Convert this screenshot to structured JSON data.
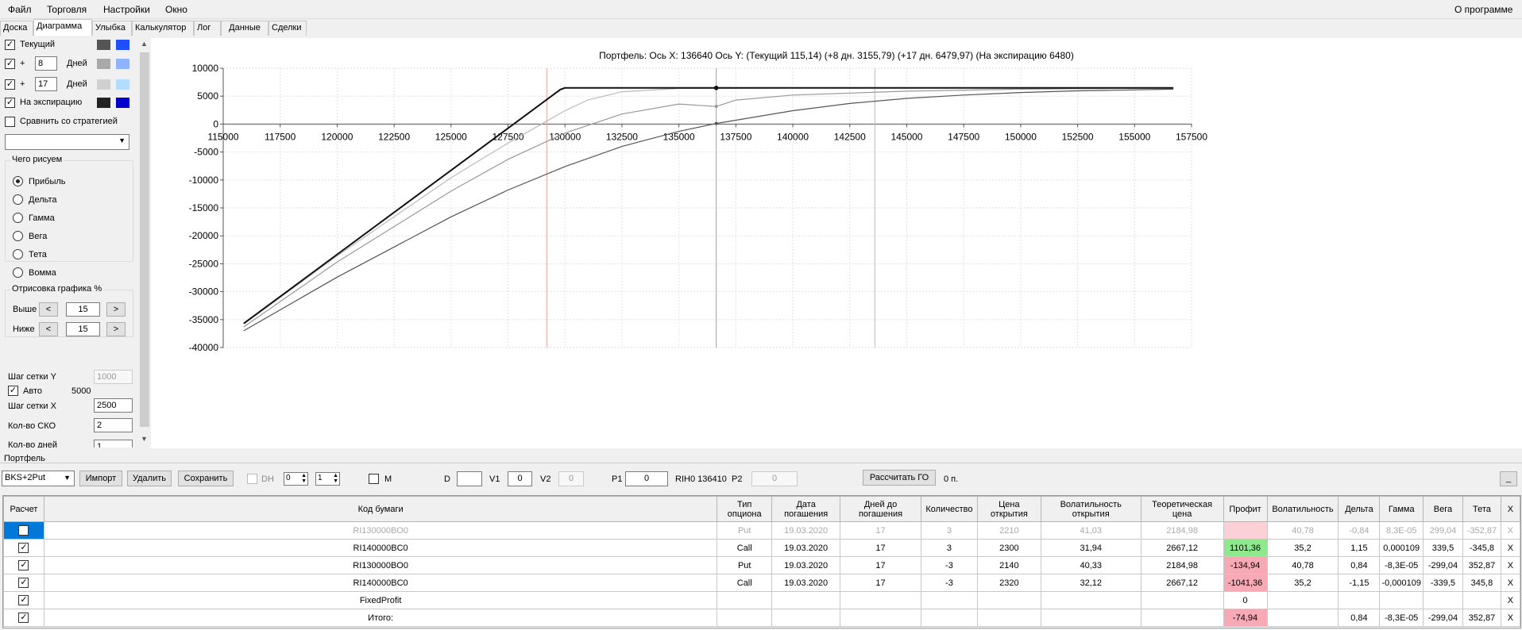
{
  "menu": {
    "file": "Файл",
    "trade": "Торговля",
    "settings": "Настройки",
    "window": "Окно",
    "about": "О программе"
  },
  "tabs": [
    "Доска",
    "Диаграмма",
    "Улыбка",
    "Калькулятор",
    "Лог",
    "Данные",
    "Сделки"
  ],
  "left": {
    "current_label": "Текущий",
    "plus1": "+",
    "days1": "8",
    "days_label1": "Дней",
    "plus2": "+",
    "days2": "17",
    "days_label2": "Дней",
    "expiry_label": "На экспирацию",
    "compare_label": "Сравнить со стратегией",
    "draw_group": "Чего рисуем",
    "radios": [
      "Прибыль",
      "Дельта",
      "Гамма",
      "Вега",
      "Тета",
      "Вомма"
    ],
    "render_group": "Отрисовка графика %",
    "above_label": "Выше",
    "above_val": "15",
    "below_label": "Ниже",
    "below_val": "15",
    "prev": "<",
    "next": ">",
    "grid_y_label": "Шаг сетки Y",
    "grid_y_val": "1000",
    "auto_label": "Авто",
    "auto_val": "5000",
    "grid_x_label": "Шаг сетки X",
    "grid_x_val": "2500",
    "sko_label": "Кол-во СКО",
    "sko_val": "2",
    "days_count_label": "Кол-во дней",
    "days_count_val": "1"
  },
  "colors": {
    "current": [
      "#555555",
      "#1f4fff"
    ],
    "plus8": [
      "#a9a9a9",
      "#8fb4ff"
    ],
    "plus17": [
      "#d0d0d0",
      "#b3dcff"
    ],
    "expiry": [
      "#222222",
      "#0000cc"
    ]
  },
  "chart_data": {
    "type": "line",
    "title": "Портфель: Ось X:  136640 Ось Y:   (Текущий 115,14)  (+8 дн. 3155,79)  (+17 дн. 6479,97)  (На экспирацию 6480)",
    "xlim": [
      115000,
      157500
    ],
    "ylim": [
      -40000,
      10000
    ],
    "x_ticks": [
      115000,
      117500,
      120000,
      122500,
      125000,
      127500,
      130000,
      132500,
      135000,
      137500,
      140000,
      142500,
      145000,
      147500,
      150000,
      152500,
      155000,
      157500
    ],
    "y_ticks": [
      10000,
      5000,
      0,
      -5000,
      -10000,
      -15000,
      -20000,
      -25000,
      -30000,
      -35000,
      -40000
    ],
    "vlines": [
      {
        "x": 129200,
        "color": "#f0a0a0"
      },
      {
        "x": 136640,
        "color": "#9999cc"
      },
      {
        "x": 143600,
        "color": "#f0a0a0"
      }
    ],
    "series": [
      {
        "color": "#111111",
        "width": 2,
        "points": [
          [
            115900,
            -35700
          ],
          [
            129800,
            6200
          ],
          [
            130000,
            6480
          ],
          [
            156700,
            6480
          ]
        ]
      },
      {
        "color": "#bbbbbb",
        "width": 1.2,
        "points": [
          [
            115900,
            -35800
          ],
          [
            120000,
            -23600
          ],
          [
            125000,
            -9600
          ],
          [
            127500,
            -3400
          ],
          [
            128800,
            -400
          ],
          [
            130000,
            2400
          ],
          [
            131000,
            4300
          ],
          [
            132500,
            5800
          ],
          [
            135000,
            6380
          ],
          [
            140000,
            6470
          ],
          [
            156700,
            6480
          ]
        ]
      },
      {
        "color": "#999999",
        "width": 1.2,
        "points": [
          [
            115900,
            -36300
          ],
          [
            120000,
            -24700
          ],
          [
            125000,
            -12000
          ],
          [
            127500,
            -6300
          ],
          [
            130000,
            -1600
          ],
          [
            132500,
            1800
          ],
          [
            135000,
            3600
          ],
          [
            136640,
            3160
          ],
          [
            137500,
            4300
          ],
          [
            140000,
            5200
          ],
          [
            145000,
            5900
          ],
          [
            150000,
            6250
          ],
          [
            156700,
            6450
          ]
        ]
      },
      {
        "color": "#555555",
        "width": 1.2,
        "points": [
          [
            115900,
            -37000
          ],
          [
            120000,
            -27400
          ],
          [
            122500,
            -22000
          ],
          [
            125000,
            -16600
          ],
          [
            127500,
            -11800
          ],
          [
            130000,
            -7600
          ],
          [
            132500,
            -4000
          ],
          [
            135000,
            -1300
          ],
          [
            136640,
            115
          ],
          [
            137500,
            700
          ],
          [
            140000,
            2400
          ],
          [
            142500,
            3700
          ],
          [
            145000,
            4600
          ],
          [
            147500,
            5200
          ],
          [
            150000,
            5650
          ],
          [
            152500,
            5950
          ],
          [
            156700,
            6250
          ]
        ]
      }
    ],
    "markers": [
      {
        "x": 136640,
        "y": 6480,
        "color": "#111111"
      },
      {
        "x": 136640,
        "y": 3160,
        "color": "#999999"
      },
      {
        "x": 136640,
        "y": 115,
        "color": "#555555"
      }
    ]
  },
  "portfolio": {
    "label": "Портфель",
    "name": "BKS+2Put",
    "import": "Импорт",
    "delete": "Удалить",
    "save": "Сохранить",
    "dh": "DH",
    "dh_v1": "0",
    "dh_v2": "1",
    "m": "M",
    "d": "D",
    "v1": "V1",
    "v1_val": "0",
    "v2": "V2",
    "v2_val": "0",
    "p1": "P1",
    "p1_val": "0",
    "rih": "RIH0 136410",
    "p2": "P2",
    "p2_val": "0",
    "calc_go": "Рассчитать ГО",
    "go_val": "0 п.",
    "minimize": "_"
  },
  "table": {
    "headers": [
      "Расчет",
      "Код бумаги",
      "Тип опциона",
      "Дата погашения",
      "Дней до погашения",
      "Количество",
      "Цена открытия",
      "Волатильность открытия",
      "Теоретическая цена",
      "Профит",
      "Волатильность",
      "Дельта",
      "Гамма",
      "Вега",
      "Тета",
      ""
    ],
    "rows": [
      {
        "check": "",
        "code": "RI130000BO0",
        "type": "Put",
        "date": "19.03.2020",
        "days": "17",
        "qty": "3",
        "price": "2210",
        "vol_open": "41,03",
        "theor": "2184,98",
        "profit": "",
        "vol": "40,78",
        "delta": "-0,84",
        "gamma": "8,3E-05",
        "vega": "299,04",
        "theta": "-352,87",
        "x": "X"
      },
      {
        "check": "✓",
        "code": "RI140000BC0",
        "type": "Call",
        "date": "19.03.2020",
        "days": "17",
        "qty": "3",
        "price": "2300",
        "vol_open": "31,94",
        "theor": "2667,12",
        "profit": "1101,36",
        "vol": "35,2",
        "delta": "1,15",
        "gamma": "0,000109",
        "vega": "339,5",
        "theta": "-345,8",
        "x": "X"
      },
      {
        "check": "✓",
        "code": "RI130000BO0",
        "type": "Put",
        "date": "19.03.2020",
        "days": "17",
        "qty": "-3",
        "price": "2140",
        "vol_open": "40,33",
        "theor": "2184,98",
        "profit": "-134,94",
        "vol": "40,78",
        "delta": "0,84",
        "gamma": "-8,3E-05",
        "vega": "-299,04",
        "theta": "352,87",
        "x": "X"
      },
      {
        "check": "✓",
        "code": "RI140000BC0",
        "type": "Call",
        "date": "19.03.2020",
        "days": "17",
        "qty": "-3",
        "price": "2320",
        "vol_open": "32,12",
        "theor": "2667,12",
        "profit": "-1041,36",
        "vol": "35,2",
        "delta": "-1,15",
        "gamma": "-0,000109",
        "vega": "-339,5",
        "theta": "345,8",
        "x": "X"
      },
      {
        "check": "✓",
        "code": "FixedProfit",
        "type": "",
        "date": "",
        "days": "",
        "qty": "",
        "price": "",
        "vol_open": "",
        "theor": "",
        "profit": "0",
        "vol": "",
        "delta": "",
        "gamma": "",
        "vega": "",
        "theta": "",
        "x": "X"
      },
      {
        "check": "✓",
        "code": "Итого:",
        "type": "",
        "date": "",
        "days": "",
        "qty": "",
        "price": "",
        "vol_open": "",
        "theor": "",
        "profit": "-74,94",
        "vol": "",
        "delta": "0,84",
        "gamma": "-8,3E-05",
        "vega": "-299,04",
        "theta": "352,87",
        "x": "X"
      }
    ]
  }
}
